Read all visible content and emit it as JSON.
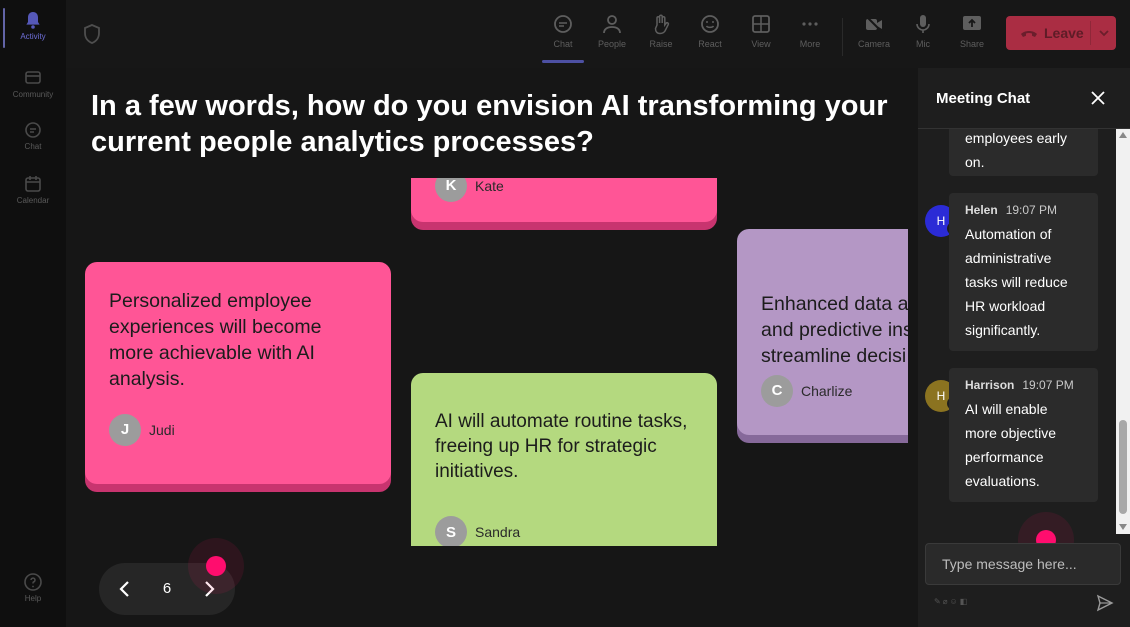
{
  "rail": {
    "items": [
      {
        "label": "Activity",
        "icon": "bell-icon",
        "active": true
      },
      {
        "label": "Community",
        "icon": "community-icon"
      },
      {
        "label": "Chat",
        "icon": "chat-icon"
      },
      {
        "label": "Calendar",
        "icon": "calendar-icon"
      }
    ],
    "help": {
      "label": "Help",
      "icon": "help-icon"
    }
  },
  "toolbar": {
    "buttons": [
      {
        "label": "Chat",
        "icon": "chat-icon",
        "active": true
      },
      {
        "label": "People",
        "icon": "people-icon"
      },
      {
        "label": "Raise",
        "icon": "raise-hand-icon"
      },
      {
        "label": "React",
        "icon": "react-icon"
      },
      {
        "label": "View",
        "icon": "view-icon"
      },
      {
        "label": "More",
        "icon": "more-icon"
      },
      {
        "label": "Camera",
        "icon": "camera-icon"
      },
      {
        "label": "Mic",
        "icon": "mic-icon"
      },
      {
        "label": "Share",
        "icon": "share-icon"
      }
    ],
    "leave_label": "Leave"
  },
  "stage": {
    "question": "In a few words, how do you envision AI transforming your current people analytics processes?",
    "cards": [
      {
        "text": "",
        "author": "Kate",
        "initial": "K",
        "color": "#ff5596"
      },
      {
        "text": "Personalized employee experiences will become more achievable with AI analysis.",
        "author": "Judi",
        "initial": "J",
        "color": "#ff5596"
      },
      {
        "text": "AI will automate routine tasks, freeing up HR for strategic initiatives.",
        "author": "Sandra",
        "initial": "S",
        "color": "#b4d97f"
      },
      {
        "text": "Enhanced data a\nand predictive ins\nstreamline decisi",
        "author": "Charlize",
        "initial": "C",
        "color": "#b497c5"
      }
    ],
    "pager": {
      "page": "6"
    }
  },
  "chat": {
    "title": "Meeting Chat",
    "messages": [
      {
        "author": "",
        "time": "",
        "initial": "",
        "text": "employees early\non."
      },
      {
        "author": "Helen",
        "time": "19:07 PM",
        "initial": "H",
        "avatar_color": "#2b2bd6",
        "text": "Automation of administrative tasks will reduce HR workload significantly."
      },
      {
        "author": "Harrison",
        "time": "19:07 PM",
        "initial": "H",
        "avatar_color": "#8b7320",
        "text": "AI will enable more objective performance evaluations."
      }
    ],
    "input_placeholder": "Type message here..."
  }
}
